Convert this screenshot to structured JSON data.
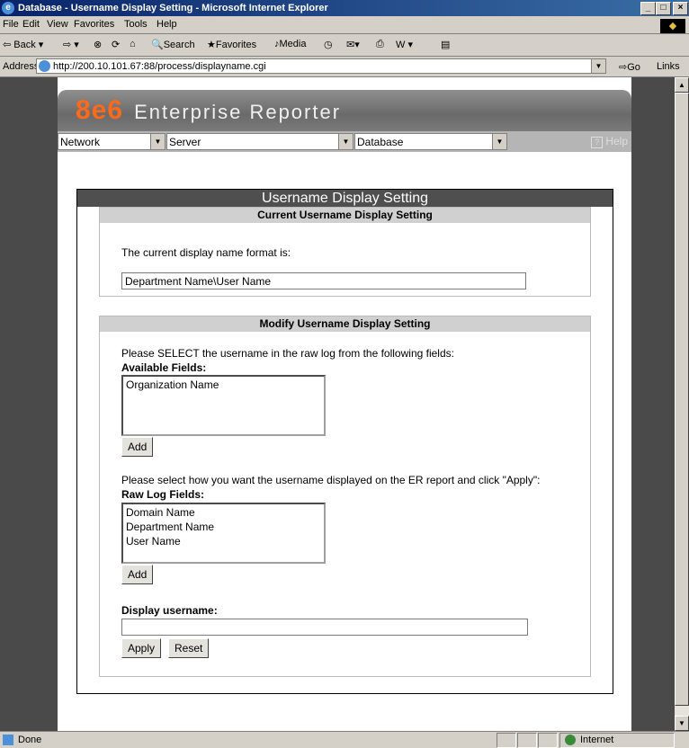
{
  "window": {
    "title": "Database - Username Display Setting - Microsoft Internet Explorer",
    "controls": [
      "_",
      "□",
      "×"
    ]
  },
  "menu": [
    "File",
    "Edit",
    "View",
    "Favorites",
    "Tools",
    "Help"
  ],
  "toolbar": {
    "back": "⇦ Back ▾",
    "forward": "⇨ ▾",
    "stop": "⊗",
    "refresh": "⟳",
    "home": "⌂",
    "search": "Search",
    "favorites": "Favorites",
    "media": "Media",
    "history": "◷",
    "mail": "✉▾",
    "print": "⎙",
    "edit": "W ▾",
    "discuss": "▤"
  },
  "address": {
    "label": "Address",
    "url": "http://200.10.101.67:88/process/displayname.cgi",
    "go": "Go",
    "links": "Links"
  },
  "app": {
    "logo_brand": "8e6",
    "logo_text": "Enterprise Reporter",
    "nav": {
      "network": "Network",
      "server": "Server",
      "database": "Database",
      "help": "Help"
    }
  },
  "panel": {
    "title": "Username Display Setting",
    "current": {
      "heading": "Current Username Display Setting",
      "label": "The current display name format is:",
      "value": "Department Name\\User Name"
    },
    "modify": {
      "heading": "Modify Username Display Setting",
      "instruction": "Please SELECT the username in the raw log from the following fields:",
      "available_label": "Available Fields:",
      "available_items": [
        "Organization Name"
      ],
      "add_label": "Add",
      "display_instruction": "Please select how you want the username displayed on the ER report and click \"Apply\":",
      "raw_label": "Raw Log Fields:",
      "raw_items": [
        "Domain Name",
        "Department Name",
        "User Name"
      ],
      "add2_label": "Add",
      "display_username_label": "Display username:",
      "display_username_value": "",
      "apply_label": "Apply",
      "reset_label": "Reset"
    }
  },
  "status": {
    "text": "Done",
    "zone": "Internet"
  }
}
